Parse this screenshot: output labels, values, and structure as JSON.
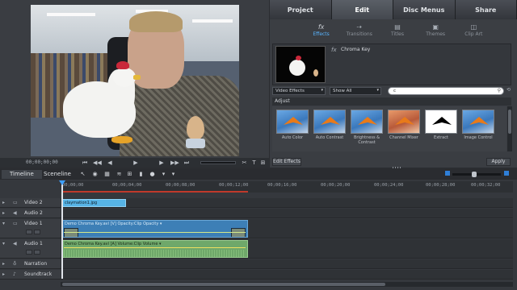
{
  "monitor": {
    "timecode": "00;00;00;00",
    "transport": [
      "⏮",
      "◀◀",
      "◀",
      "▶",
      "▶",
      "▶▶",
      "⏭"
    ],
    "tools": [
      "✂",
      "T",
      "⊞"
    ]
  },
  "tasks": {
    "tabs": [
      "Project",
      "Edit",
      "Disc Menus",
      "Share"
    ],
    "active_tab": "Edit",
    "subtabs": [
      {
        "label": "Effects",
        "icon": "fx-icon"
      },
      {
        "label": "Transitions",
        "icon": "transitions-icon"
      },
      {
        "label": "Titles",
        "icon": "titles-icon"
      },
      {
        "label": "Themes",
        "icon": "themes-icon"
      },
      {
        "label": "Clip Art",
        "icon": "clip-art-icon"
      }
    ],
    "active_subtab": "Effects",
    "applied_effect": "Chroma Key",
    "category_dropdown": "Video Effects",
    "show_dropdown": "Show All",
    "search_value": "c",
    "section_title": "Adjust",
    "effects": [
      {
        "label": "Auto Color"
      },
      {
        "label": "Auto Contrast"
      },
      {
        "label": "Brightness & Contrast"
      },
      {
        "label": "Channel Mixer"
      },
      {
        "label": "Extract"
      },
      {
        "label": "Image Control"
      }
    ],
    "edit_effects_label": "Edit Effects",
    "apply_label": "Apply"
  },
  "timeline": {
    "tabs": [
      "Timeline",
      "Sceneline"
    ],
    "active_tab": "Timeline",
    "ruler": [
      "00;00;00",
      "00;00;04;00",
      "00;00;08;00",
      "00;00;12;00",
      "00;00;16;00",
      "00;00;20;00",
      "00;00;24;00",
      "00;00;28;00",
      "00;00;32;00"
    ],
    "tracks": [
      {
        "name": "Video 2",
        "kind": "video"
      },
      {
        "name": "Audio 2",
        "kind": "audio"
      },
      {
        "name": "Video 1",
        "kind": "video"
      },
      {
        "name": "Audio 1",
        "kind": "audio"
      },
      {
        "name": "Narration",
        "kind": "narration"
      },
      {
        "name": "Soundtrack",
        "kind": "soundtrack"
      }
    ],
    "clips": {
      "still": "claymation1.jpg",
      "video": "Demo Chroma Key.avi [V] Opacity:Clip Opacity ▾",
      "audio": "Demo Chroma Key.avi [A] Volume:Clip Volume ▾"
    }
  }
}
